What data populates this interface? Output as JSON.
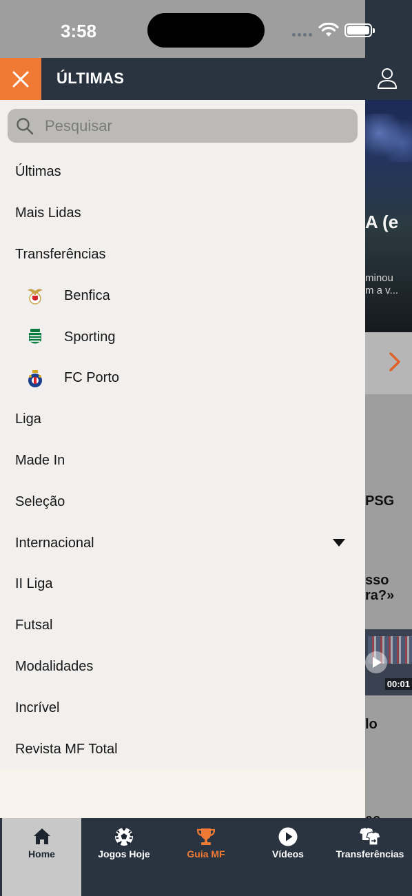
{
  "status_bar": {
    "time": "3:58"
  },
  "app_bar": {
    "title": "ÚLTIMAS"
  },
  "search": {
    "placeholder": "Pesquisar"
  },
  "menu": {
    "items": [
      {
        "label": "Últimas"
      },
      {
        "label": "Mais Lidas"
      },
      {
        "label": "Transferências"
      },
      {
        "label": "Benfica",
        "icon": "benfica-crest-icon"
      },
      {
        "label": "Sporting",
        "icon": "sporting-crest-icon"
      },
      {
        "label": "FC Porto",
        "icon": "fc-porto-crest-icon"
      },
      {
        "label": "Liga"
      },
      {
        "label": "Made In"
      },
      {
        "label": "Seleção"
      },
      {
        "label": "Internacional",
        "expandable": true
      },
      {
        "label": "II Liga"
      },
      {
        "label": "Futsal"
      },
      {
        "label": "Modalidades"
      },
      {
        "label": "Incrível"
      },
      {
        "label": "Revista MF Total"
      }
    ]
  },
  "background": {
    "hero_headline_fragment": "A (e",
    "hero_snippet_line1": "minou",
    "hero_snippet_line2": "m a v...",
    "story1_fragment": "PSG",
    "story2_line1": "sso",
    "story2_line2": "ra?»",
    "video_duration": "00:01",
    "story3_fragment": "lo",
    "story4_fragment": "as"
  },
  "tab_bar": {
    "tabs": [
      {
        "label": "Home",
        "icon": "home-icon",
        "active": true
      },
      {
        "label": "Jogos Hoje",
        "icon": "soccer-ball-icon"
      },
      {
        "label": "Guia MF",
        "icon": "trophy-icon",
        "highlight": true
      },
      {
        "label": "Vídeos",
        "icon": "play-icon"
      },
      {
        "label": "Transferências",
        "icon": "jersey-swap-icon"
      }
    ]
  },
  "colors": {
    "header_bg": "#2a3441",
    "accent": "#f07a33",
    "drawer_bg": "#f2f0ee",
    "search_bg": "#bcbab6"
  }
}
